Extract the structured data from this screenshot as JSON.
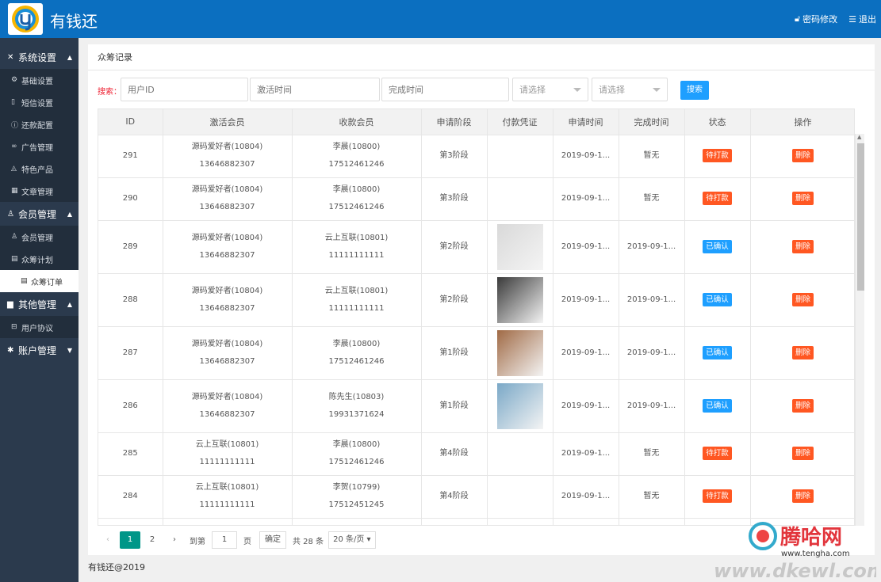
{
  "header": {
    "app_title": "有钱还",
    "change_password": "密码修改",
    "logout": "退出"
  },
  "sidebar": {
    "groups": [
      {
        "label": "系统设置",
        "items": [
          "基础设置",
          "短信设置",
          "还款配置",
          "广告管理",
          "特色产品",
          "文章管理"
        ]
      },
      {
        "label": "会员管理",
        "items": [
          "会员管理",
          "众筹计划",
          "众筹订单"
        ]
      },
      {
        "label": "其他管理",
        "items": [
          "用户协议"
        ]
      },
      {
        "label": "账户管理",
        "items": []
      }
    ]
  },
  "panel": {
    "title": "众筹记录"
  },
  "search": {
    "label": "搜索：",
    "user_id_placeholder": "用户ID",
    "activate_time_placeholder": "激活时间",
    "complete_time_placeholder": "完成时间",
    "select1": "请选择",
    "select2": "请选择",
    "button": "搜索"
  },
  "table": {
    "headers": [
      "ID",
      "激活会员",
      "收款会员",
      "申请阶段",
      "付款凭证",
      "申请时间",
      "完成时间",
      "状态",
      "操作"
    ],
    "rows": [
      {
        "id": "291",
        "activator": "源码爱好者(10804)",
        "activator_phone": "13646882307",
        "payee": "李晨(10800)",
        "payee_phone": "17512461246",
        "stage": "第3阶段",
        "apply_time": "2019-09-1...",
        "complete_time": "暂无",
        "status": "待打款",
        "action": "删除"
      },
      {
        "id": "290",
        "activator": "源码爱好者(10804)",
        "activator_phone": "13646882307",
        "payee": "李晨(10800)",
        "payee_phone": "17512461246",
        "stage": "第3阶段",
        "apply_time": "2019-09-1...",
        "complete_time": "暂无",
        "status": "待打款",
        "action": "删除"
      },
      {
        "id": "289",
        "activator": "源码爱好者(10804)",
        "activator_phone": "13646882307",
        "payee": "云上互联(10801)",
        "payee_phone": "11111111111",
        "stage": "第2阶段",
        "apply_time": "2019-09-1...",
        "complete_time": "2019-09-1...",
        "status": "已确认",
        "action": "删除"
      },
      {
        "id": "288",
        "activator": "源码爱好者(10804)",
        "activator_phone": "13646882307",
        "payee": "云上互联(10801)",
        "payee_phone": "11111111111",
        "stage": "第2阶段",
        "apply_time": "2019-09-1...",
        "complete_time": "2019-09-1...",
        "status": "已确认",
        "action": "删除"
      },
      {
        "id": "287",
        "activator": "源码爱好者(10804)",
        "activator_phone": "13646882307",
        "payee": "李晨(10800)",
        "payee_phone": "17512461246",
        "stage": "第1阶段",
        "apply_time": "2019-09-1...",
        "complete_time": "2019-09-1...",
        "status": "已确认",
        "action": "删除"
      },
      {
        "id": "286",
        "activator": "源码爱好者(10804)",
        "activator_phone": "13646882307",
        "payee": "陈先生(10803)",
        "payee_phone": "19931371624",
        "stage": "第1阶段",
        "apply_time": "2019-09-1...",
        "complete_time": "2019-09-1...",
        "status": "已确认",
        "action": "删除"
      },
      {
        "id": "285",
        "activator": "云上互联(10801)",
        "activator_phone": "11111111111",
        "payee": "李晨(10800)",
        "payee_phone": "17512461246",
        "stage": "第4阶段",
        "apply_time": "2019-09-1...",
        "complete_time": "暂无",
        "status": "待打款",
        "action": "删除"
      },
      {
        "id": "284",
        "activator": "云上互联(10801)",
        "activator_phone": "11111111111",
        "payee": "李贺(10799)",
        "payee_phone": "17512451245",
        "stage": "第4阶段",
        "apply_time": "2019-09-1...",
        "complete_time": "暂无",
        "status": "待打款",
        "action": "删除"
      }
    ]
  },
  "pager": {
    "page1": "1",
    "page2": "2",
    "goto": "到第",
    "goto_value": "1",
    "page_unit": "页",
    "confirm": "确定",
    "total": "共 28 条",
    "page_size": "20 条/页"
  },
  "footer": {
    "copyright": "有钱还@2019"
  },
  "watermark": {
    "brand": "腾哈网",
    "url1": "www.tengha.com",
    "url2": "www.dkewl.com"
  }
}
